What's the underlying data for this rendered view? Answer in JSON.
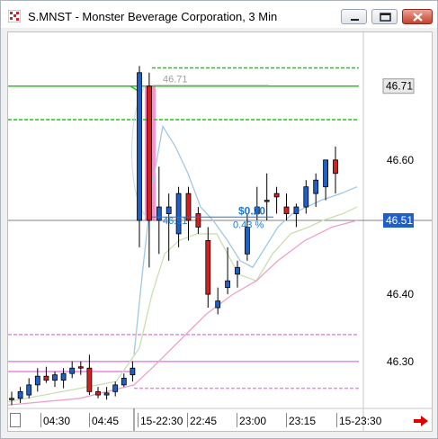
{
  "window": {
    "title": "S.MNST - Monster Beverage Corporation, 3 Min",
    "icon": "chart-app-icon",
    "buttons": [
      "minimize-icon",
      "restore-icon",
      "close-icon"
    ]
  },
  "chart": {
    "symbol": "S.MNST",
    "price_axis_labels": [
      "46.71",
      "46.60",
      "46.51",
      "46.40",
      "46.30"
    ],
    "current_price": "46.51",
    "level_price": "46.71",
    "level_note": "46.71",
    "start_price_note": "46.51",
    "change_abs": "$0.20",
    "change_pct": "0.43 %",
    "time_labels": [
      "04:30",
      "04:45",
      "15-22:30",
      "22:45",
      "23:00",
      "23:15",
      "15-23:30"
    ],
    "colors": {
      "up_candle": "#1e5fc8",
      "down_candle": "#d42020",
      "green_level": "#1ec81e",
      "magenta_level": "#ee82ee",
      "highlight": "#ff69b4",
      "ma_fast": "#a0c8e8",
      "ma_mid": "#c8e0b0",
      "ma_slow": "#f0a0c8",
      "note_text": "#1e78d2"
    }
  },
  "chart_data": {
    "type": "candlestick",
    "title": "S.MNST - Monster Beverage Corporation, 3 Min",
    "ylim": [
      46.23,
      46.79
    ],
    "y_ticks": [
      46.3,
      46.4,
      46.5,
      46.6,
      46.71
    ],
    "x_ticks": [
      "04:30",
      "04:45",
      "15-22:30",
      "22:45",
      "23:00",
      "23:15",
      "15-23:30"
    ],
    "candles": [
      {
        "o": 46.245,
        "h": 46.255,
        "l": 46.235,
        "c": 46.245
      },
      {
        "o": 46.245,
        "h": 46.262,
        "l": 46.238,
        "c": 46.255
      },
      {
        "o": 46.25,
        "h": 46.275,
        "l": 46.245,
        "c": 46.265
      },
      {
        "o": 46.265,
        "h": 46.29,
        "l": 46.255,
        "c": 46.278
      },
      {
        "o": 46.278,
        "h": 46.292,
        "l": 46.268,
        "c": 46.272
      },
      {
        "o": 46.272,
        "h": 46.285,
        "l": 46.262,
        "c": 46.28
      },
      {
        "o": 46.272,
        "h": 46.29,
        "l": 46.26,
        "c": 46.282
      },
      {
        "o": 46.282,
        "h": 46.3,
        "l": 46.275,
        "c": 46.29
      },
      {
        "o": 46.292,
        "h": 46.3,
        "l": 46.28,
        "c": 46.29
      },
      {
        "o": 46.29,
        "h": 46.31,
        "l": 46.25,
        "c": 46.255
      },
      {
        "o": 46.255,
        "h": 46.262,
        "l": 46.245,
        "c": 46.25
      },
      {
        "o": 46.25,
        "h": 46.262,
        "l": 46.243,
        "c": 46.253
      },
      {
        "o": 46.255,
        "h": 46.27,
        "l": 46.248,
        "c": 46.265
      },
      {
        "o": 46.265,
        "h": 46.282,
        "l": 46.262,
        "c": 46.275
      },
      {
        "o": 46.28,
        "h": 46.3,
        "l": 46.27,
        "c": 46.29
      },
      {
        "o": 46.51,
        "h": 46.74,
        "l": 46.47,
        "c": 46.73
      },
      {
        "o": 46.71,
        "h": 46.73,
        "l": 46.44,
        "c": 46.51
      },
      {
        "o": 46.51,
        "h": 46.59,
        "l": 46.46,
        "c": 46.53
      },
      {
        "o": 46.52,
        "h": 46.55,
        "l": 46.45,
        "c": 46.53
      },
      {
        "o": 46.49,
        "h": 46.56,
        "l": 46.47,
        "c": 46.55
      },
      {
        "o": 46.55,
        "h": 46.56,
        "l": 46.48,
        "c": 46.51
      },
      {
        "o": 46.52,
        "h": 46.53,
        "l": 46.49,
        "c": 46.5
      },
      {
        "o": 46.48,
        "h": 46.5,
        "l": 46.38,
        "c": 46.4
      },
      {
        "o": 46.38,
        "h": 46.41,
        "l": 46.37,
        "c": 46.39
      },
      {
        "o": 46.41,
        "h": 46.47,
        "l": 46.4,
        "c": 46.42
      },
      {
        "o": 46.43,
        "h": 46.45,
        "l": 46.41,
        "c": 46.44
      },
      {
        "o": 46.46,
        "h": 46.52,
        "l": 46.45,
        "c": 46.5
      },
      {
        "o": 46.52,
        "h": 46.56,
        "l": 46.51,
        "c": 46.53
      },
      {
        "o": 46.54,
        "h": 46.58,
        "l": 46.51,
        "c": 46.54
      },
      {
        "o": 46.55,
        "h": 46.56,
        "l": 46.52,
        "c": 46.545
      },
      {
        "o": 46.53,
        "h": 46.55,
        "l": 46.51,
        "c": 46.52
      },
      {
        "o": 46.52,
        "h": 46.535,
        "l": 46.5,
        "c": 46.53
      },
      {
        "o": 46.53,
        "h": 46.57,
        "l": 46.52,
        "c": 46.56
      },
      {
        "o": 46.55,
        "h": 46.58,
        "l": 46.53,
        "c": 46.57
      },
      {
        "o": 46.56,
        "h": 46.6,
        "l": 46.54,
        "c": 46.6
      },
      {
        "o": 46.6,
        "h": 46.62,
        "l": 46.55,
        "c": 46.58
      }
    ],
    "levels": [
      {
        "price": 46.737,
        "style": "dash",
        "color": "green"
      },
      {
        "price": 46.71,
        "style": "solid",
        "color": "green"
      },
      {
        "price": 46.66,
        "style": "dash",
        "color": "green"
      },
      {
        "price": 46.51,
        "style": "solid",
        "color": "gray"
      },
      {
        "price": 46.34,
        "style": "dash",
        "color": "magenta"
      },
      {
        "price": 46.3,
        "style": "solid",
        "color": "magenta"
      },
      {
        "price": 46.26,
        "style": "dash",
        "color": "magenta"
      }
    ]
  }
}
